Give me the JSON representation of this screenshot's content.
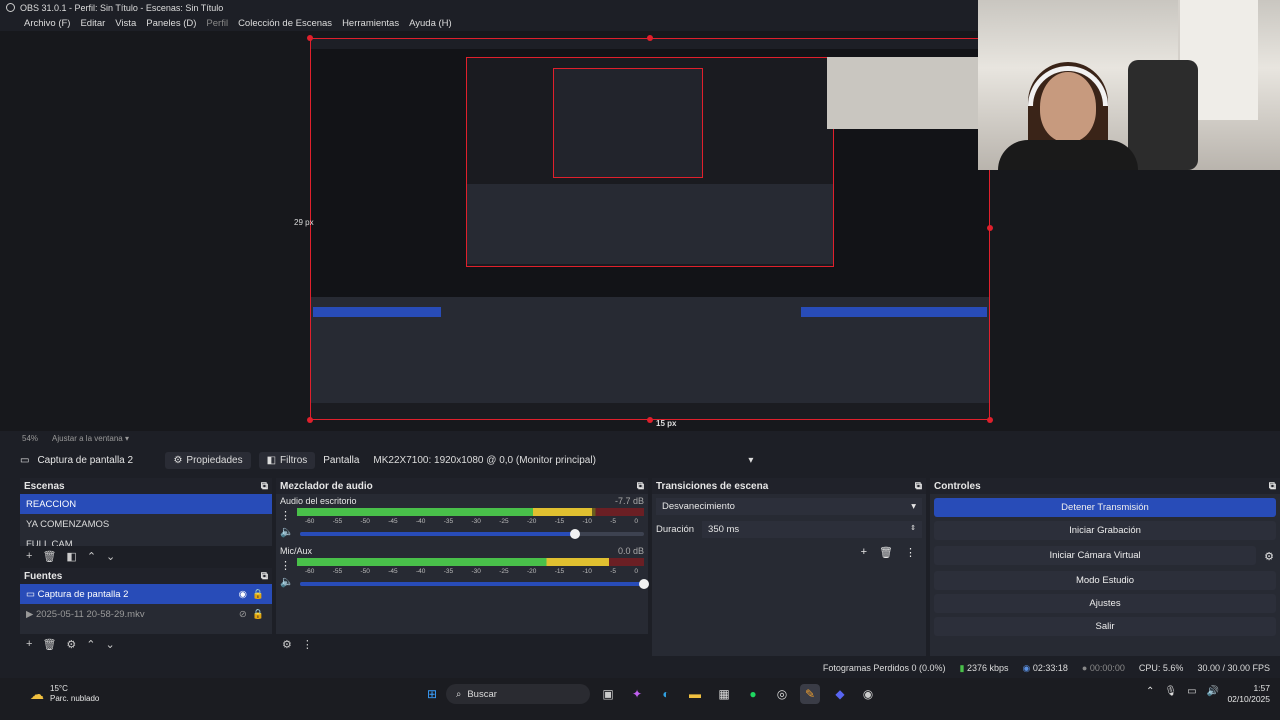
{
  "window": {
    "title": "OBS 31.0.1 - Perfil: Sin Título - Escenas: Sin Título"
  },
  "menu": [
    {
      "label": "Archivo (F)",
      "enabled": true
    },
    {
      "label": "Editar",
      "enabled": true
    },
    {
      "label": "Vista",
      "enabled": true
    },
    {
      "label": "Paneles (D)",
      "enabled": true
    },
    {
      "label": "Perfil",
      "enabled": false
    },
    {
      "label": "Colección de Escenas",
      "enabled": true
    },
    {
      "label": "Herramientas",
      "enabled": true
    },
    {
      "label": "Ayuda (H)",
      "enabled": true
    }
  ],
  "preview": {
    "top_offset_label": "29 px",
    "bottom_offset_label": "15 px",
    "zoom": "54%",
    "fit_label": "Ajustar a la ventana"
  },
  "sourcebar": {
    "source_name": "Captura de pantalla 2",
    "properties_label": "Propiedades",
    "filters_label": "Filtros",
    "screen_label": "Pantalla",
    "screen_value": "MK22X7100: 1920x1080 @ 0,0 (Monitor principal)"
  },
  "scenes": {
    "title": "Escenas",
    "items": [
      {
        "label": "REACCION",
        "selected": true
      },
      {
        "label": "YA COMENZAMOS",
        "selected": false
      },
      {
        "label": "FULL CAM",
        "selected": false
      }
    ]
  },
  "sources": {
    "title": "Fuentes",
    "items": [
      {
        "label": "Captura de pantalla 2",
        "selected": true,
        "icon": "monitor-icon"
      },
      {
        "label": "2025-05-11 20-58-29.mkv",
        "selected": false,
        "icon": "play-icon"
      }
    ]
  },
  "mixer": {
    "title": "Mezclador de audio",
    "channels": [
      {
        "name": "Audio del escritorio",
        "db": "-7.7 dB",
        "level": 0.85,
        "volume": 0.8
      },
      {
        "name": "Mic/Aux",
        "db": "0.0 dB",
        "level": 0.9,
        "volume": 1.0
      }
    ],
    "scale": [
      "-60",
      "-55",
      "-50",
      "-45",
      "-40",
      "-35",
      "-30",
      "-25",
      "-20",
      "-15",
      "-10",
      "-5",
      "0"
    ]
  },
  "transitions": {
    "title": "Transiciones de escena",
    "selected": "Desvanecimiento",
    "duration_label": "Duración",
    "duration_value": "350 ms"
  },
  "controls": {
    "title": "Controles",
    "buttons": [
      {
        "label": "Detener Transmisión",
        "primary": true
      },
      {
        "label": "Iniciar Grabación",
        "primary": false
      },
      {
        "label": "Iniciar Cámara Virtual",
        "primary": false
      },
      {
        "label": "Modo Estudio",
        "primary": false
      },
      {
        "label": "Ajustes",
        "primary": false
      },
      {
        "label": "Salir",
        "primary": false
      }
    ]
  },
  "status": {
    "dropped": "Fotogramas Perdidos 0 (0.0%)",
    "bitrate": "2376 kbps",
    "stream_time": "02:33:18",
    "rec_time": "00:00:00",
    "cpu": "CPU: 5.6%",
    "fps": "30.00 / 30.00 FPS"
  },
  "taskbar": {
    "weather_temp": "15°C",
    "weather_desc": "Parc. nublado",
    "search_label": "Buscar",
    "time": "1:57",
    "date": "02/10/2025"
  },
  "colors": {
    "accent": "#284cb8",
    "selection_border": "#e0202c",
    "panel_bg": "#272a33"
  }
}
